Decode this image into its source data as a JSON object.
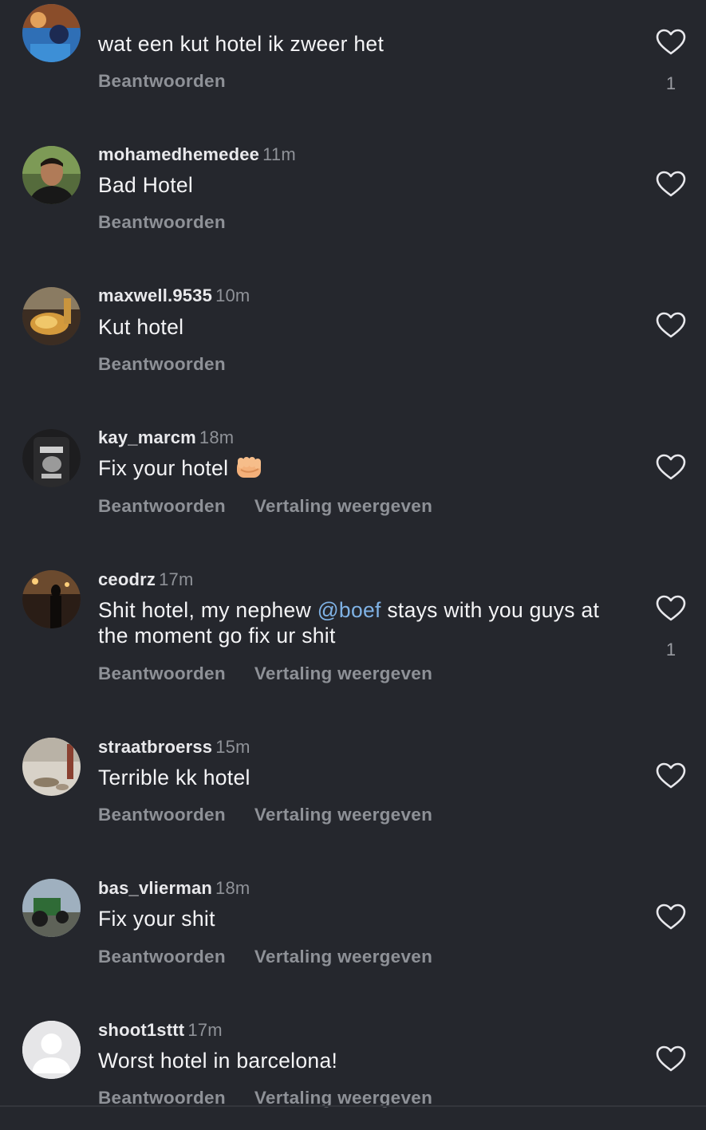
{
  "comments": [
    {
      "username": "",
      "time": "",
      "text": "wat een kut hotel ik zweer het",
      "reply": "Beantwoorden",
      "translate": "",
      "likes": "1",
      "avatar": "colorful-photo"
    },
    {
      "username": "mohamedhemedee",
      "time": "11m",
      "text": "Bad Hotel",
      "reply": "Beantwoorden",
      "translate": "",
      "likes": "",
      "avatar": "man-portrait"
    },
    {
      "username": "maxwell.9535",
      "time": "10m",
      "text": "Kut hotel",
      "reply": "Beantwoorden",
      "translate": "",
      "likes": "",
      "avatar": "food-photo"
    },
    {
      "username": "kay_marcm",
      "time": "18m",
      "text": "Fix your hotel",
      "emoji": "oncoming-fist",
      "reply": "Beantwoorden",
      "translate": "Vertaling weergeven",
      "likes": "",
      "avatar": "bronx-jacket"
    },
    {
      "username": "ceodrz",
      "time": "17m",
      "text_before": "Shit hotel, my nephew ",
      "mention": "@boef",
      "text_after": " stays with you guys at the moment go fix ur shit",
      "reply": "Beantwoorden",
      "translate": "Vertaling weergeven",
      "likes": "1",
      "avatar": "dark-figure"
    },
    {
      "username": "straatbroerss",
      "time": "15m",
      "text": "Terrible kk hotel",
      "reply": "Beantwoorden",
      "translate": "Vertaling weergeven",
      "likes": "",
      "avatar": "street-photo"
    },
    {
      "username": "bas_vlierman",
      "time": "18m",
      "text": "Fix your shit",
      "reply": "Beantwoorden",
      "translate": "Vertaling weergeven",
      "likes": "",
      "avatar": "tractor-photo"
    },
    {
      "username": "shoot1sttt",
      "time": "17m",
      "text": "Worst hotel in barcelona!",
      "reply": "Beantwoorden",
      "translate": "Vertaling weergeven",
      "likes": "",
      "avatar": "default-avatar"
    }
  ],
  "colors": {
    "background": "#25272d",
    "text": "#f4f4f6",
    "muted": "#8e9197",
    "mention": "#7fb2e5"
  }
}
